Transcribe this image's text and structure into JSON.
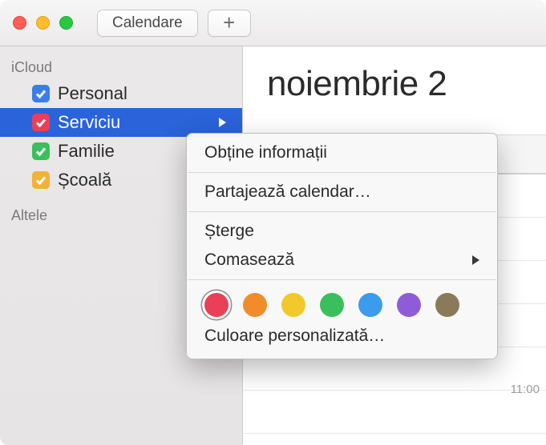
{
  "toolbar": {
    "calendars_label": "Calendare",
    "add_label": "+"
  },
  "sidebar": {
    "section1_label": "iCloud",
    "section2_label": "Altele",
    "calendars": [
      {
        "name": "Personal",
        "color": "#3b7ded",
        "checked": true,
        "selected": false
      },
      {
        "name": "Serviciu",
        "color": "#e94057",
        "checked": true,
        "selected": true
      },
      {
        "name": "Familie",
        "color": "#3bbf5c",
        "checked": true,
        "selected": false
      },
      {
        "name": "Școală",
        "color": "#f2b23a",
        "checked": true,
        "selected": false
      }
    ]
  },
  "main": {
    "month_title": "noiembrie 2",
    "time_11": "11:00"
  },
  "context_menu": {
    "get_info": "Obține informații",
    "share": "Partajează calendar…",
    "delete": "Șterge",
    "merge": "Comasează",
    "custom_color": "Culoare personalizată…",
    "colors": [
      "#e94057",
      "#f28c2b",
      "#f2c92b",
      "#3bbf5c",
      "#3b9bed",
      "#8e5cd9",
      "#8a7a5a"
    ],
    "selected_color_index": 0
  }
}
